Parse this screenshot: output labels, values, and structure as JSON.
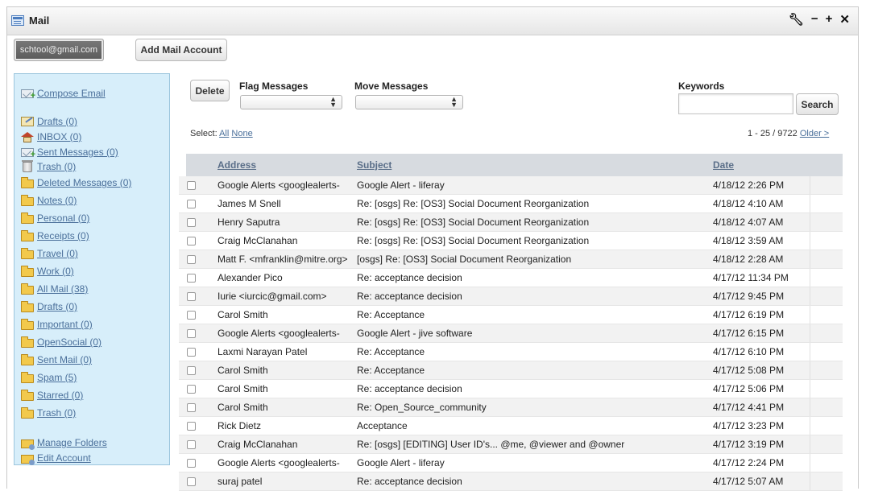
{
  "window": {
    "title": "Mail",
    "controls": [
      "wrench-icon",
      "minimize-icon",
      "maximize-icon",
      "close-icon"
    ]
  },
  "account": {
    "email": "schtool@gmail.com",
    "add_label": "Add Mail Account"
  },
  "sidebar": {
    "compose": "Compose Email",
    "system_folders": [
      {
        "label": "Drafts (0)",
        "icon": "draft-icon"
      },
      {
        "label": "INBOX (0)",
        "icon": "home-icon"
      },
      {
        "label": "Sent Messages (0)",
        "icon": "sent-icon"
      },
      {
        "label": "Trash (0)",
        "icon": "trash-icon"
      }
    ],
    "folders": [
      "Deleted Messages (0)",
      "Notes (0)",
      "Personal (0)",
      "Receipts (0)",
      "Travel (0)",
      "Work (0)",
      "All Mail (38)",
      "Drafts (0)",
      "Important (0)",
      "OpenSocial (0)",
      "Sent Mail (0)",
      "Spam (5)",
      "Starred (0)",
      "Trash (0)"
    ],
    "manage": "Manage Folders",
    "edit": "Edit Account"
  },
  "toolbar": {
    "delete_label": "Delete",
    "flag_label": "Flag Messages",
    "flag_value": "",
    "move_label": "Move Messages",
    "move_value": "",
    "keywords_label": "Keywords",
    "keywords_value": "",
    "search_label": "Search"
  },
  "selection": {
    "prefix": "Select:",
    "all": "All",
    "none": "None"
  },
  "paging": {
    "range": "1 - 25 / 9722",
    "older": "Older >"
  },
  "table": {
    "columns": [
      "Address",
      "Subject",
      "Date"
    ],
    "rows": [
      {
        "address": "Google Alerts <googlealerts-",
        "subject": "Google Alert - liferay",
        "date": "4/18/12 2:26 PM"
      },
      {
        "address": "James M Snell",
        "subject": "Re: [osgs] Re: [OS3] Social Document Reorganization",
        "date": "4/18/12 4:10 AM"
      },
      {
        "address": "Henry Saputra",
        "subject": "Re: [osgs] Re: [OS3] Social Document Reorganization",
        "date": "4/18/12 4:07 AM"
      },
      {
        "address": "Craig McClanahan",
        "subject": "Re: [osgs] Re: [OS3] Social Document Reorganization",
        "date": "4/18/12 3:59 AM"
      },
      {
        "address": "Matt F. <mfranklin@mitre.org>",
        "subject": "[osgs] Re: [OS3] Social Document Reorganization",
        "date": "4/18/12 2:28 AM"
      },
      {
        "address": "Alexander Pico",
        "subject": "Re: acceptance decision",
        "date": "4/17/12 11:34 PM"
      },
      {
        "address": "Iurie <iurcic@gmail.com>",
        "subject": "Re: acceptance decision",
        "date": "4/17/12 9:45 PM"
      },
      {
        "address": "Carol Smith",
        "subject": "Re: Acceptance",
        "date": "4/17/12 6:19 PM"
      },
      {
        "address": "Google Alerts <googlealerts-",
        "subject": "Google Alert - jive software",
        "date": "4/17/12 6:15 PM"
      },
      {
        "address": "Laxmi Narayan Patel",
        "subject": "Re: Acceptance",
        "date": "4/17/12 6:10 PM"
      },
      {
        "address": "Carol Smith",
        "subject": "Re: Acceptance",
        "date": "4/17/12 5:08 PM"
      },
      {
        "address": "Carol Smith",
        "subject": "Re: acceptance decision",
        "date": "4/17/12 5:06 PM"
      },
      {
        "address": "Carol Smith",
        "subject": "Re: Open_Source_community",
        "date": "4/17/12 4:41 PM"
      },
      {
        "address": "Rick Dietz",
        "subject": "Acceptance",
        "date": "4/17/12 3:23 PM"
      },
      {
        "address": "Craig McClanahan",
        "subject": "Re: [osgs] [EDITING] User ID's... @me, @viewer and @owner",
        "date": "4/17/12 3:19 PM"
      },
      {
        "address": "Google Alerts <googlealerts-",
        "subject": "Google Alert - liferay",
        "date": "4/17/12 2:24 PM"
      },
      {
        "address": "suraj patel",
        "subject": "Re: acceptance decision",
        "date": "4/17/12 5:07 AM"
      }
    ]
  }
}
